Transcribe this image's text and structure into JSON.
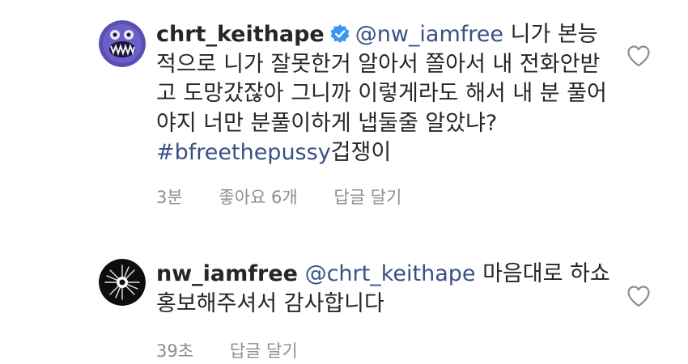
{
  "comments": [
    {
      "username": "chrt_keithape",
      "verified": true,
      "mention": "@nw_iamfree",
      "text": "니가 본능적으로 니가 잘못한거 알아서 쫄아서 내 전화안받고 도망갔잖아 그니까 이렇게라도 해서 내 분 풀어야지 너만 분풀이하게 냅둘줄 알았냐?",
      "hashtag": "#bfreethepussy",
      "text_after": "겁쟁이",
      "time": "3분",
      "likes": "좋아요 6개",
      "reply": "답글 달기"
    },
    {
      "username": "nw_iamfree",
      "verified": false,
      "mention": "@chrt_keithape",
      "text": "마음대로 하쇼 홍보해주셔서 감사합니다",
      "time": "39초",
      "reply": "답글 달기"
    }
  ],
  "icons": {
    "like": "heart-outline-icon",
    "verified": "verified-badge-icon"
  },
  "colors": {
    "link": "#385185",
    "meta": "#8e8e8e",
    "text": "#262626",
    "verified": "#3897f0"
  }
}
